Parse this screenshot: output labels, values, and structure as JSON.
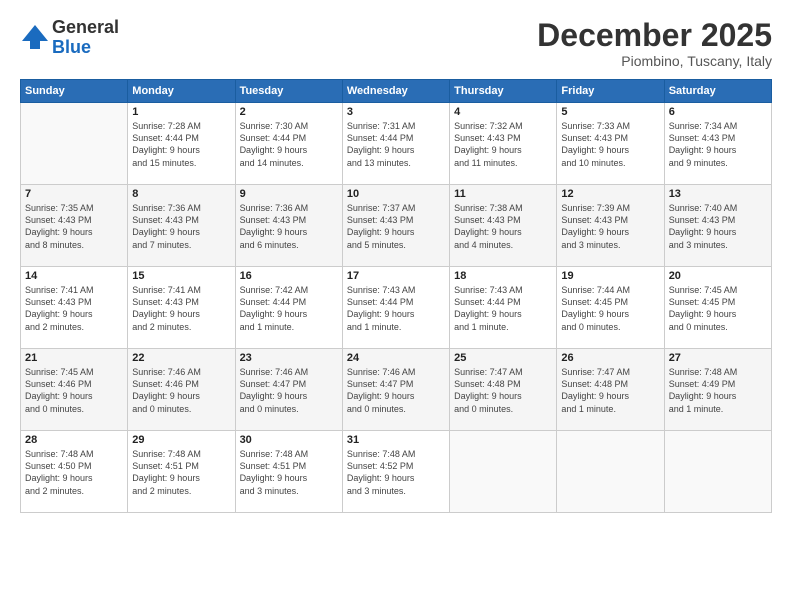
{
  "logo": {
    "general": "General",
    "blue": "Blue"
  },
  "title": "December 2025",
  "subtitle": "Piombino, Tuscany, Italy",
  "headers": [
    "Sunday",
    "Monday",
    "Tuesday",
    "Wednesday",
    "Thursday",
    "Friday",
    "Saturday"
  ],
  "weeks": [
    [
      {
        "num": "",
        "info": ""
      },
      {
        "num": "1",
        "info": "Sunrise: 7:28 AM\nSunset: 4:44 PM\nDaylight: 9 hours\nand 15 minutes."
      },
      {
        "num": "2",
        "info": "Sunrise: 7:30 AM\nSunset: 4:44 PM\nDaylight: 9 hours\nand 14 minutes."
      },
      {
        "num": "3",
        "info": "Sunrise: 7:31 AM\nSunset: 4:44 PM\nDaylight: 9 hours\nand 13 minutes."
      },
      {
        "num": "4",
        "info": "Sunrise: 7:32 AM\nSunset: 4:43 PM\nDaylight: 9 hours\nand 11 minutes."
      },
      {
        "num": "5",
        "info": "Sunrise: 7:33 AM\nSunset: 4:43 PM\nDaylight: 9 hours\nand 10 minutes."
      },
      {
        "num": "6",
        "info": "Sunrise: 7:34 AM\nSunset: 4:43 PM\nDaylight: 9 hours\nand 9 minutes."
      }
    ],
    [
      {
        "num": "7",
        "info": "Sunrise: 7:35 AM\nSunset: 4:43 PM\nDaylight: 9 hours\nand 8 minutes."
      },
      {
        "num": "8",
        "info": "Sunrise: 7:36 AM\nSunset: 4:43 PM\nDaylight: 9 hours\nand 7 minutes."
      },
      {
        "num": "9",
        "info": "Sunrise: 7:36 AM\nSunset: 4:43 PM\nDaylight: 9 hours\nand 6 minutes."
      },
      {
        "num": "10",
        "info": "Sunrise: 7:37 AM\nSunset: 4:43 PM\nDaylight: 9 hours\nand 5 minutes."
      },
      {
        "num": "11",
        "info": "Sunrise: 7:38 AM\nSunset: 4:43 PM\nDaylight: 9 hours\nand 4 minutes."
      },
      {
        "num": "12",
        "info": "Sunrise: 7:39 AM\nSunset: 4:43 PM\nDaylight: 9 hours\nand 3 minutes."
      },
      {
        "num": "13",
        "info": "Sunrise: 7:40 AM\nSunset: 4:43 PM\nDaylight: 9 hours\nand 3 minutes."
      }
    ],
    [
      {
        "num": "14",
        "info": "Sunrise: 7:41 AM\nSunset: 4:43 PM\nDaylight: 9 hours\nand 2 minutes."
      },
      {
        "num": "15",
        "info": "Sunrise: 7:41 AM\nSunset: 4:43 PM\nDaylight: 9 hours\nand 2 minutes."
      },
      {
        "num": "16",
        "info": "Sunrise: 7:42 AM\nSunset: 4:44 PM\nDaylight: 9 hours\nand 1 minute."
      },
      {
        "num": "17",
        "info": "Sunrise: 7:43 AM\nSunset: 4:44 PM\nDaylight: 9 hours\nand 1 minute."
      },
      {
        "num": "18",
        "info": "Sunrise: 7:43 AM\nSunset: 4:44 PM\nDaylight: 9 hours\nand 1 minute."
      },
      {
        "num": "19",
        "info": "Sunrise: 7:44 AM\nSunset: 4:45 PM\nDaylight: 9 hours\nand 0 minutes."
      },
      {
        "num": "20",
        "info": "Sunrise: 7:45 AM\nSunset: 4:45 PM\nDaylight: 9 hours\nand 0 minutes."
      }
    ],
    [
      {
        "num": "21",
        "info": "Sunrise: 7:45 AM\nSunset: 4:46 PM\nDaylight: 9 hours\nand 0 minutes."
      },
      {
        "num": "22",
        "info": "Sunrise: 7:46 AM\nSunset: 4:46 PM\nDaylight: 9 hours\nand 0 minutes."
      },
      {
        "num": "23",
        "info": "Sunrise: 7:46 AM\nSunset: 4:47 PM\nDaylight: 9 hours\nand 0 minutes."
      },
      {
        "num": "24",
        "info": "Sunrise: 7:46 AM\nSunset: 4:47 PM\nDaylight: 9 hours\nand 0 minutes."
      },
      {
        "num": "25",
        "info": "Sunrise: 7:47 AM\nSunset: 4:48 PM\nDaylight: 9 hours\nand 0 minutes."
      },
      {
        "num": "26",
        "info": "Sunrise: 7:47 AM\nSunset: 4:48 PM\nDaylight: 9 hours\nand 1 minute."
      },
      {
        "num": "27",
        "info": "Sunrise: 7:48 AM\nSunset: 4:49 PM\nDaylight: 9 hours\nand 1 minute."
      }
    ],
    [
      {
        "num": "28",
        "info": "Sunrise: 7:48 AM\nSunset: 4:50 PM\nDaylight: 9 hours\nand 2 minutes."
      },
      {
        "num": "29",
        "info": "Sunrise: 7:48 AM\nSunset: 4:51 PM\nDaylight: 9 hours\nand 2 minutes."
      },
      {
        "num": "30",
        "info": "Sunrise: 7:48 AM\nSunset: 4:51 PM\nDaylight: 9 hours\nand 3 minutes."
      },
      {
        "num": "31",
        "info": "Sunrise: 7:48 AM\nSunset: 4:52 PM\nDaylight: 9 hours\nand 3 minutes."
      },
      {
        "num": "",
        "info": ""
      },
      {
        "num": "",
        "info": ""
      },
      {
        "num": "",
        "info": ""
      }
    ]
  ]
}
